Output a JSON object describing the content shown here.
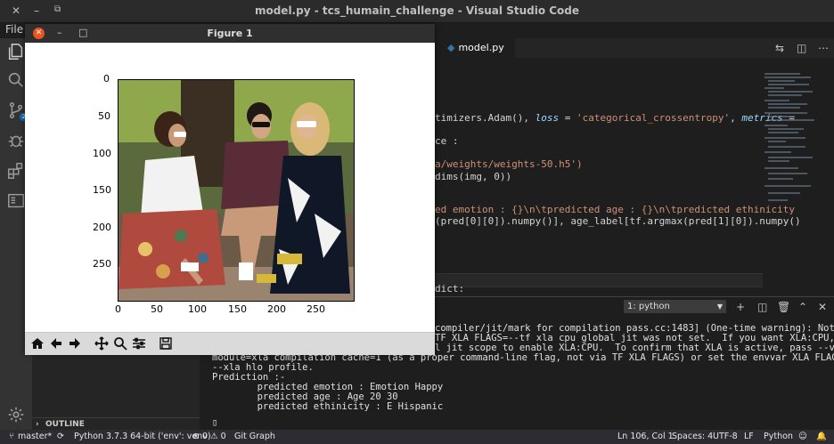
{
  "window": {
    "title": "model.py - tcs_humain_challenge - Visual Studio Code"
  },
  "menu": {
    "file": "File"
  },
  "tabs": [
    {
      "label": "model.py"
    }
  ],
  "code_lines": [
    {
      "pre": "timizers.Adam(), ",
      "kw1": "loss",
      "mid": " = ",
      "str1": "'categorical_crossentropy'",
      "mid2": ", ",
      "kw2": "metrics",
      "post": " ="
    },
    {
      "text": "ce :"
    },
    {
      "text": "a/weights/weights-50.h5')",
      "str": true
    },
    {
      "text": "dims(img, 0))"
    },
    {
      "text": "ed emotion : {}\\n\\tpredicted age : {}\\n\\tpredicted ethinicity",
      "str": true
    },
    {
      "text": "(pred[0][0]).numpy()], age_label[tf.argmax(pred[1][0]).numpy()"
    },
    {
      "text": "dict:"
    }
  ],
  "panel": {
    "terminal_select": "1: python"
  },
  "terminal": [
    "compiler/jit/mark for compilation pass.cc:1483] (One-time warning): Not",
    "TF XLA FLAGS=--tf xla cpu global jit was not set.  If you want XLA:CPU,",
    "l jit scope to enable XLA:CPU.  To confirm that XLA is active, pass --v",
    "module=xla compilation cache=1 (as a proper command-line flag, not via TF XLA FLAGS) or set the envvar XLA FLAGS=",
    "--xla hlo profile.",
    "Prediction :-",
    "        predicted emotion : Emotion Happy",
    "        predicted age : Age 20 30",
    "        predicted ethinicity : E Hispanic",
    "",
    "▯"
  ],
  "outline": "OUTLINE",
  "status": {
    "branch": "master*",
    "python": "Python 3.7.3 64-bit ('env': venv)",
    "problems": "⊗ 0 ⚠ 0",
    "gitgraph": "Git Graph",
    "position": "Ln 106, Col 1",
    "spaces": "Spaces: 4",
    "encoding": "UTF-8",
    "eol": "LF",
    "language": "Python"
  },
  "figure": {
    "title": "Figure 1",
    "x_ticks": [
      "0",
      "50",
      "100",
      "150",
      "200",
      "250"
    ],
    "y_ticks": [
      "0",
      "50",
      "100",
      "150",
      "200",
      "250"
    ]
  }
}
